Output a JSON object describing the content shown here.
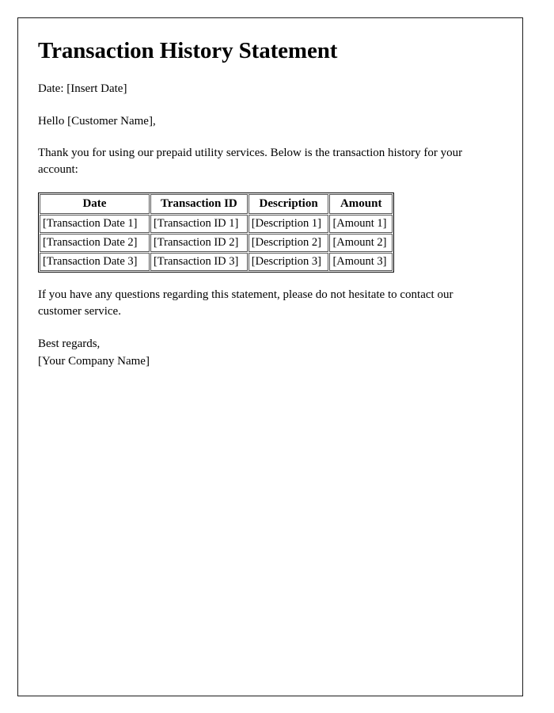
{
  "document": {
    "title": "Transaction History Statement",
    "date_line": "Date: [Insert Date]",
    "greeting": "Hello [Customer Name],",
    "intro_paragraph": "Thank you for using our prepaid utility services. Below is the transaction history for your account:",
    "closing_paragraph": "If you have any questions regarding this statement, please do not hesitate to contact our customer service.",
    "sign_off": "Best regards,",
    "company_name": "[Your Company Name]"
  },
  "table": {
    "headers": [
      "Date",
      "Transaction ID",
      "Description",
      "Amount"
    ],
    "rows": [
      [
        "[Transaction Date 1]",
        "[Transaction ID 1]",
        "[Description 1]",
        "[Amount 1]"
      ],
      [
        "[Transaction Date 2]",
        "[Transaction ID 2]",
        "[Description 2]",
        "[Amount 2]"
      ],
      [
        "[Transaction Date 3]",
        "[Transaction ID 3]",
        "[Description 3]",
        "[Amount 3]"
      ]
    ]
  },
  "colors": {
    "text": "#000000",
    "page_background": "#ffffff",
    "page_border": "#1a1a1a",
    "table_border": "#000000",
    "cell_border": "#555555"
  }
}
